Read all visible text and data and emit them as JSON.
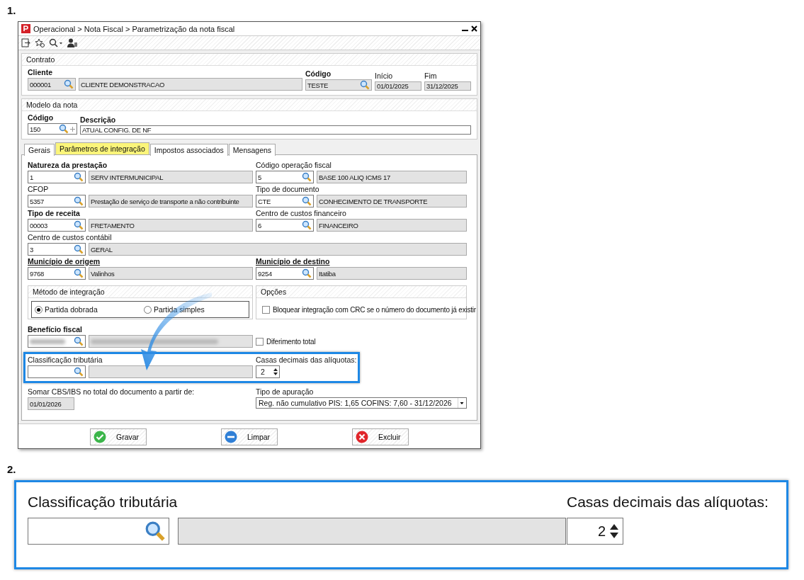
{
  "step_labels": [
    "1.",
    "2."
  ],
  "window": {
    "title": "Operacional > Nota Fiscal > Parametrização da nota fiscal"
  },
  "contrato": {
    "title": "Contrato",
    "cliente": {
      "label": "Cliente",
      "code": "000001",
      "description": "CLIENTE DEMONSTRACAO"
    },
    "codigo": {
      "label": "Código",
      "value": "TESTE"
    },
    "inicio": {
      "label": "Início",
      "value": "01/01/2025"
    },
    "fim": {
      "label": "Fim",
      "value": "31/12/2025"
    }
  },
  "modelo": {
    "title": "Modelo da nota",
    "codigo": {
      "label": "Código",
      "value": "150"
    },
    "descricao": {
      "label": "Descrição",
      "value": "ATUAL CONFIG. DE NF"
    }
  },
  "tabs": [
    {
      "label": "Gerais",
      "selected": false
    },
    {
      "label": "Parâmetros de integração",
      "selected": true
    },
    {
      "label": "Impostos associados",
      "selected": false
    },
    {
      "label": "Mensagens",
      "selected": false
    }
  ],
  "field_rows": [
    [
      {
        "label": "Natureza da prestação",
        "kind": "required",
        "code": "1",
        "description": "SERV INTERMUNICIPAL"
      },
      {
        "label": "Código operação fiscal",
        "kind": "optional",
        "code": "5",
        "description": "BASE 100 ALIQ ICMS 17"
      }
    ],
    [
      {
        "label": "CFOP",
        "kind": "optional",
        "code": "5357",
        "description": "Prestação de serviço de transporte a não contribuinte"
      },
      {
        "label": "Tipo de documento",
        "kind": "optional",
        "code": "CTE",
        "description": "CONHECIMENTO DE TRANSPORTE"
      }
    ],
    [
      {
        "label": "Tipo de receita",
        "kind": "required",
        "code": "00003",
        "description": "FRETAMENTO"
      },
      {
        "label": "Centro de custos financeiro",
        "kind": "optional",
        "code": "6",
        "description": "FINANCEIRO"
      }
    ],
    [
      {
        "label": "Centro de custos contábil",
        "kind": "optional",
        "code": "3",
        "description": "GERAL"
      }
    ],
    [
      {
        "label": "Município de origem",
        "kind": "linked",
        "code": "9768",
        "description": "Valinhos"
      },
      {
        "label": "Município de destino",
        "kind": "linked",
        "code": "9254",
        "description": "Itatiba"
      }
    ]
  ],
  "metodo": {
    "title": "Método de integração",
    "options": [
      {
        "label": "Partida dobrada",
        "selected": true
      },
      {
        "label": "Partida simples",
        "selected": false
      }
    ]
  },
  "opcoes": {
    "title": "Opções",
    "checkbox": {
      "label": "Bloquear integração com CRC se o número do documento já existir",
      "checked": false
    }
  },
  "beneficio": {
    "label": "Benefício fiscal",
    "blurred": true
  },
  "diferimento": {
    "label": "Diferimento total",
    "checked": false
  },
  "classificacao": {
    "label": "Classificação tributária"
  },
  "casas": {
    "label": "Casas decimais das alíquotas:",
    "value": "2"
  },
  "zoom_detail": {
    "classificacao_label": "Classificação tributária",
    "casas_label": "Casas decimais das alíquotas:",
    "casas_value": "2"
  },
  "somar": {
    "label": "Somar CBS/IBS no total do documento a partir de:",
    "value": "01/01/2026"
  },
  "apuracao": {
    "label": "Tipo de apuração",
    "value": "Reg. não cumulativo PIS: 1,65 COFINS: 7,60 - 31/12/2026"
  },
  "buttons": [
    {
      "label": "Gravar",
      "kind": "ok"
    },
    {
      "label": "Limpar",
      "kind": "clear"
    },
    {
      "label": "Excluir",
      "kind": "delete"
    }
  ]
}
